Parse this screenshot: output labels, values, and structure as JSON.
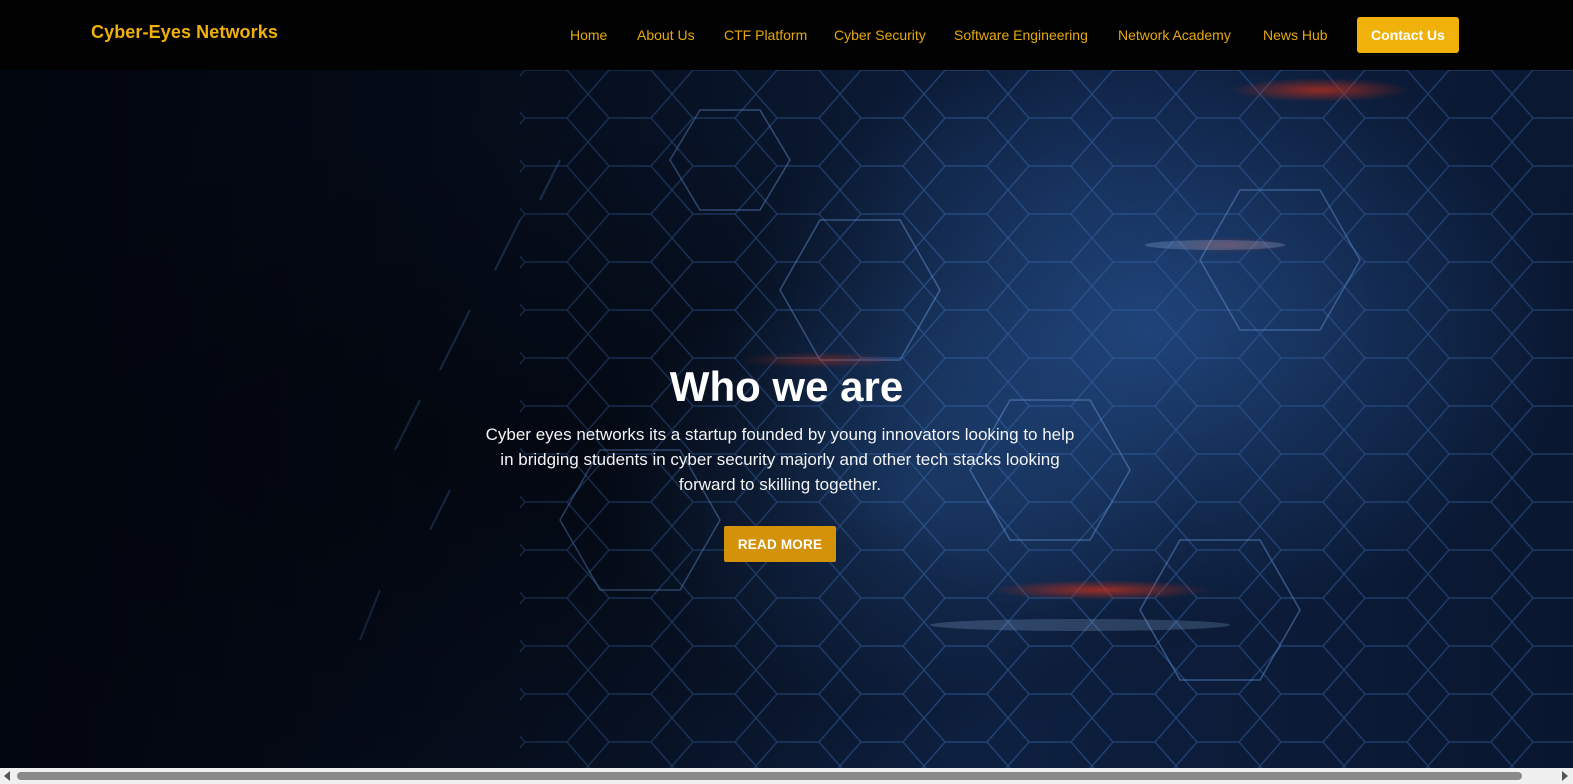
{
  "navbar": {
    "brand": "Cyber-Eyes Networks",
    "links": [
      {
        "label": "Home"
      },
      {
        "label": "About Us"
      },
      {
        "label": "CTF Platform"
      },
      {
        "label": "Cyber Security"
      },
      {
        "label": "Software Engineering"
      },
      {
        "label": "Network Academy"
      },
      {
        "label": "News Hub"
      }
    ],
    "contact_label": "Contact Us"
  },
  "hero": {
    "title": "Who we are",
    "text": "Cyber eyes networks its a startup founded by young innovators looking to help in bridging students in cyber security majorly and other tech stacks looking forward to skilling together.",
    "button_label": "READ MORE"
  },
  "colors": {
    "brand": "#f0b10b",
    "nav_link": "#e6a90c",
    "button": "#d4920a",
    "navbar_bg": "#020202",
    "hero_bg": "#0b1a33"
  },
  "icons": {
    "scroll_left": "triangle-left-icon",
    "scroll_right": "triangle-right-icon"
  }
}
